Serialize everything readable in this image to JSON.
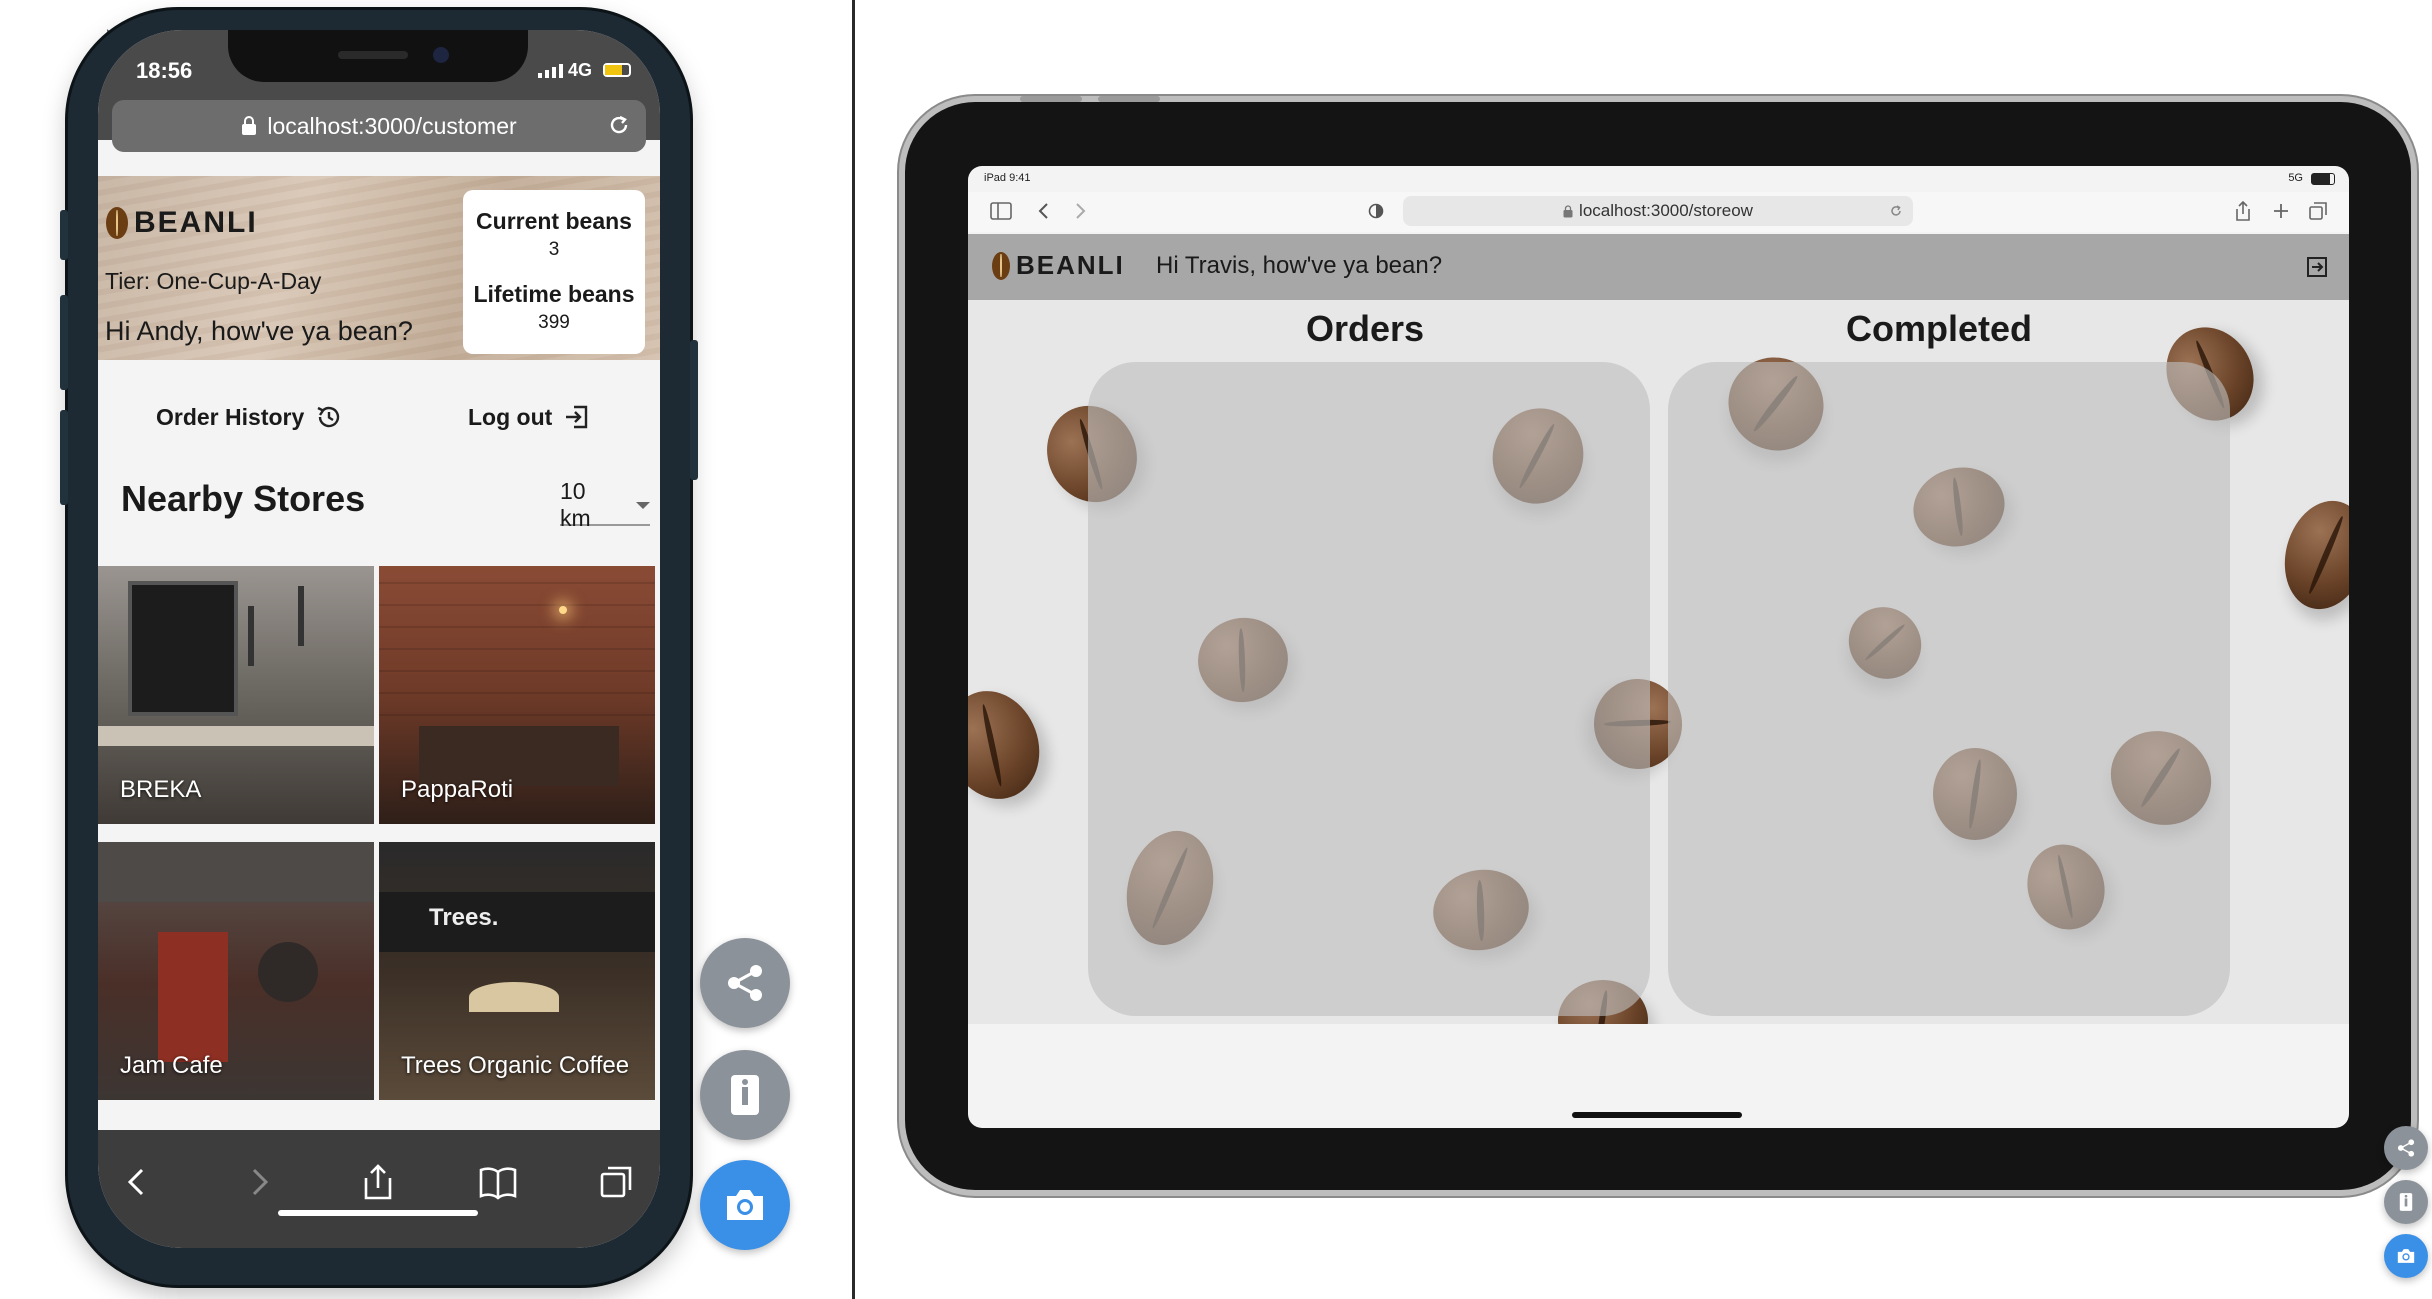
{
  "phone": {
    "status": {
      "time": "18:56",
      "network": "4G"
    },
    "url": "localhost:3000/customer",
    "brand": "BEANLI",
    "tier": "Tier: One-Cup-A-Day",
    "greeting": "Hi Andy, how've ya bean?",
    "beans": {
      "current_label": "Current beans",
      "current_value": "3",
      "lifetime_label": "Lifetime beans",
      "lifetime_value": "399"
    },
    "nav": {
      "order_history": "Order History",
      "logout": "Log out"
    },
    "nearby_title": "Nearby Stores",
    "radius": "10 km",
    "stores": [
      {
        "name": "BREKA"
      },
      {
        "name": "PappaRoti"
      },
      {
        "name": "Jam Cafe"
      },
      {
        "name": "Trees Organic Coffee"
      }
    ]
  },
  "tablet": {
    "status": {
      "left": "iPad 9:41",
      "right": "5G"
    },
    "url": "localhost:3000/storeow",
    "brand": "BEANLI",
    "greeting": "Hi Travis, how've ya bean?",
    "columns": {
      "orders": "Orders",
      "completed": "Completed"
    }
  },
  "colors": {
    "fab_blue": "#3a8fe6",
    "fab_gray": "#8b9299",
    "header_gray": "#a7a7a7"
  },
  "icons": [
    "share-icon",
    "device-icon",
    "camera-icon",
    "history-icon",
    "logout-icon",
    "lock-icon",
    "reload-icon"
  ]
}
